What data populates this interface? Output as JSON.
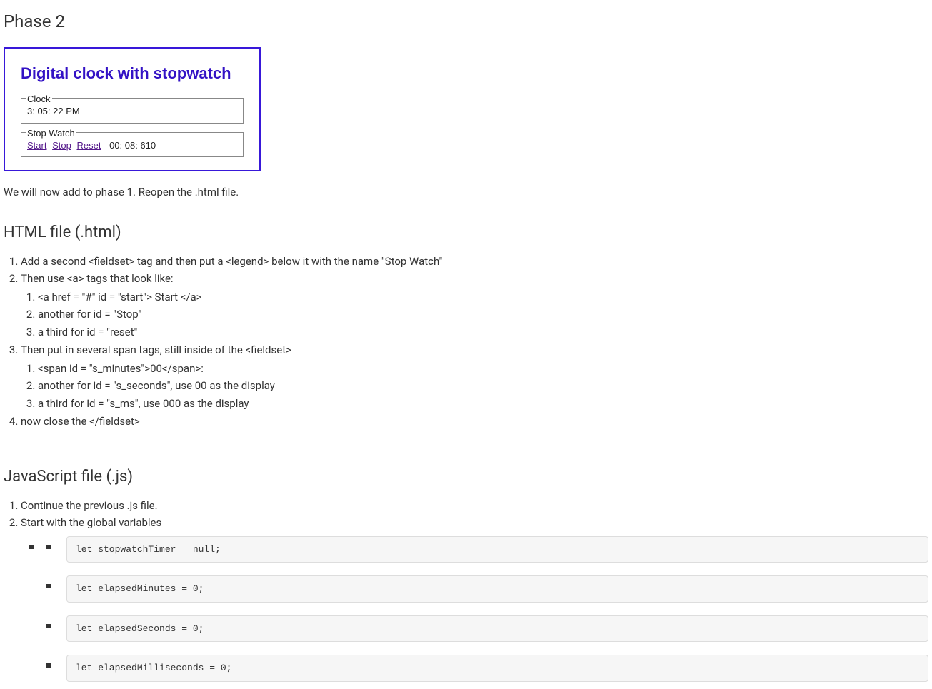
{
  "page": {
    "title": "Phase 2",
    "intro": "We will now add to phase 1.  Reopen the .html file."
  },
  "demo": {
    "heading": "Digital clock with stopwatch",
    "clock": {
      "legend": "Clock",
      "time": "3: 05: 22   PM"
    },
    "stopwatch": {
      "legend": "Stop Watch",
      "start_label": "Start",
      "stop_label": "Stop",
      "reset_label": "Reset",
      "time": "00: 08: 610"
    }
  },
  "html_section": {
    "heading": "HTML file (.html)",
    "items": {
      "i1": "Add a second <fieldset> tag and then put a <legend> below it with the name \"Stop Watch\"",
      "i2": "Then use <a> tags that look like:",
      "i2_sub": {
        "s1": "<a href = \"#\" id = \"start\"> Start </a>",
        "s2": "another for id = \"Stop\"",
        "s3": "a third for id = \"reset\""
      },
      "i3": "Then put in several span tags, still inside of the <fieldset>",
      "i3_sub": {
        "s1": "<span id = \"s_minutes\">00</span>:",
        "s2": "another for id = \"s_seconds\", use 00 as the display",
        "s3": "a third for  id = \"s_ms\", use 000 as the display"
      },
      "i4": "now close the </fieldset>"
    }
  },
  "js_section": {
    "heading": "JavaScript file (.js)",
    "items": {
      "i1": "Continue the previous .js file.",
      "i2": "Start with the global variables"
    },
    "code": {
      "c1": "let stopwatchTimer = null;",
      "c2": "let elapsedMinutes = 0;",
      "c3": "let elapsedSeconds = 0;",
      "c4": "let elapsedMilliseconds = 0;"
    }
  }
}
